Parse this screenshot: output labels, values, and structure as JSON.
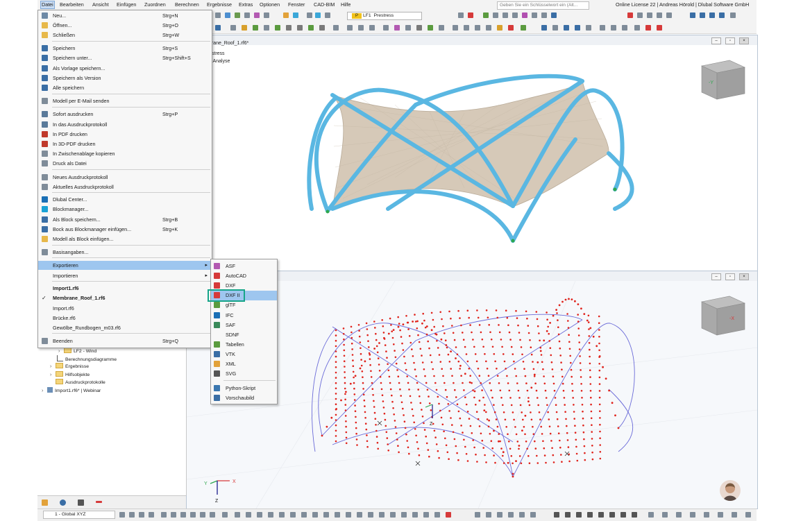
{
  "menubar": {
    "items": [
      "Datei",
      "Bearbeiten",
      "Ansicht",
      "Einfügen",
      "Zuordnen",
      "Berechnen",
      "Ergebnisse",
      "Extras",
      "Optionen",
      "Fenster",
      "CAD-BIM",
      "Hilfe"
    ],
    "search_placeholder": "Geben Sie ein Schlüsselwort ein (Alt...",
    "license_text": "Online License 22 | Andreas Hörold | Dlubal Software GmbH"
  },
  "toolbar": {
    "load_case_badge": "P",
    "load_case_id": "LF1",
    "load_case_name": "Prestress"
  },
  "view_top": {
    "title": "brane_Roof_1.rf6*",
    "info_line1": "estress",
    "info_line2": "e Analyse"
  },
  "datei_menu": {
    "items": [
      {
        "label": "Neu...",
        "shortcut": "Strg+N",
        "icon": "new-file-icon"
      },
      {
        "label": "Öffnen...",
        "shortcut": "Strg+O",
        "icon": "open-folder-icon"
      },
      {
        "label": "Schließen",
        "shortcut": "Strg+W",
        "icon": "close-file-icon"
      },
      {
        "label": "Speichern",
        "shortcut": "Strg+S",
        "icon": "save-icon"
      },
      {
        "label": "Speichern unter...",
        "shortcut": "Strg+Shift+S",
        "icon": "save-as-icon"
      },
      {
        "label": "Als Vorlage speichern...",
        "shortcut": "",
        "icon": "save-template-icon"
      },
      {
        "label": "Speichern als Version",
        "shortcut": "",
        "icon": "save-version-icon"
      },
      {
        "label": "Alle speichern",
        "shortcut": "",
        "icon": "save-all-icon"
      },
      {
        "label": "Modell per E-Mail senden",
        "shortcut": "",
        "icon": "email-icon"
      },
      {
        "label": "Sofort ausdrucken",
        "shortcut": "Strg+P",
        "icon": "print-icon"
      },
      {
        "label": "In das Ausdruckprotokoll",
        "shortcut": "",
        "icon": "printout-report-icon"
      },
      {
        "label": "In PDF drucken",
        "shortcut": "",
        "icon": "pdf-icon"
      },
      {
        "label": "In 3D-PDF drucken",
        "shortcut": "",
        "icon": "pdf-3d-icon"
      },
      {
        "label": "In Zwischenablage kopieren",
        "shortcut": "",
        "icon": "clipboard-icon"
      },
      {
        "label": "Druck als Datei",
        "shortcut": "",
        "icon": "print-file-icon"
      },
      {
        "label": "Neues Ausdruckprotokoll",
        "shortcut": "",
        "icon": "new-report-icon"
      },
      {
        "label": "Aktuelles Ausdruckprotokoll",
        "shortcut": "",
        "icon": "current-report-icon"
      },
      {
        "label": "Dlubal Center...",
        "shortcut": "",
        "icon": "dlubal-center-icon"
      },
      {
        "label": "Blockmanager...",
        "shortcut": "",
        "icon": "block-manager-icon"
      },
      {
        "label": "Als Block speichern...",
        "shortcut": "Strg+B",
        "icon": "save-block-icon"
      },
      {
        "label": "Bock aus Blockmanager einfügen...",
        "shortcut": "Strg+K",
        "icon": "insert-block-icon"
      },
      {
        "label": "Modell als Block einfügen...",
        "shortcut": "",
        "icon": "model-block-icon"
      },
      {
        "label": "Basisangaben...",
        "shortcut": "",
        "icon": "base-data-icon"
      },
      {
        "label": "Exportieren",
        "shortcut": "",
        "icon": ""
      },
      {
        "label": "Importieren",
        "shortcut": "",
        "icon": ""
      },
      {
        "label": "Import1.rf6",
        "shortcut": "",
        "icon": ""
      },
      {
        "label": "Membrane_Roof_1.rf6",
        "shortcut": "",
        "icon": "check-icon"
      },
      {
        "label": "Import.rf6",
        "shortcut": "",
        "icon": ""
      },
      {
        "label": "Brücke.rf6",
        "shortcut": "",
        "icon": ""
      },
      {
        "label": "Gewölbe_Rundbogen_m03.rf6",
        "shortcut": "",
        "icon": ""
      },
      {
        "label": "Beenden",
        "shortcut": "Strg+Q",
        "icon": "exit-icon"
      }
    ]
  },
  "export_menu": {
    "items": [
      {
        "label": "ASF",
        "icon": "asf-icon"
      },
      {
        "label": "AutoCAD",
        "icon": "autocad-icon"
      },
      {
        "label": "DXF",
        "icon": "dxf-icon"
      },
      {
        "label": "DXF II",
        "icon": "dxf2-icon"
      },
      {
        "label": "glTF",
        "icon": "gltf-icon"
      },
      {
        "label": "IFC",
        "icon": "ifc-icon"
      },
      {
        "label": "SAF",
        "icon": "saf-icon"
      },
      {
        "label": "SDNF",
        "icon": "sdnf-icon"
      },
      {
        "label": "Tabellen",
        "icon": "tables-icon"
      },
      {
        "label": "VTK",
        "icon": "vtk-icon"
      },
      {
        "label": "XML",
        "icon": "xml-icon"
      },
      {
        "label": "SVG",
        "icon": "svg-icon"
      },
      {
        "label": "Python-Skript",
        "icon": "python-icon"
      },
      {
        "label": "Vorschaubild",
        "icon": "thumbnail-icon"
      }
    ]
  },
  "navigator": {
    "rows": [
      {
        "label": "LF2 - Wind",
        "indent": 2,
        "chevron": true,
        "folder": true
      },
      {
        "label": "Berechnungsdiagramme",
        "indent": 1,
        "chevron": false,
        "folder": false
      },
      {
        "label": "Ergebnisse",
        "indent": 1,
        "chevron": true,
        "folder": true
      },
      {
        "label": "Hilfsobjekte",
        "indent": 1,
        "chevron": true,
        "folder": true
      },
      {
        "label": "Ausdruckprotokolle",
        "indent": 1,
        "chevron": false,
        "folder": true
      },
      {
        "label": "Import1.rf6* | Webinar",
        "indent": 0,
        "chevron": true,
        "folder": false
      }
    ]
  },
  "statusbar": {
    "cs_combo": "1 - Global XYZ"
  },
  "axes": {
    "x": "X",
    "y": "Y",
    "z": "Z"
  },
  "colors": {
    "menu_highlight": "#9ec6ef",
    "focus_box": "#17a589",
    "member_blue": "#5ab7e2",
    "membrane": "#d6c9b8",
    "fe_nodes": "#e0231c",
    "mesh_lines": "#6a6ad8"
  }
}
